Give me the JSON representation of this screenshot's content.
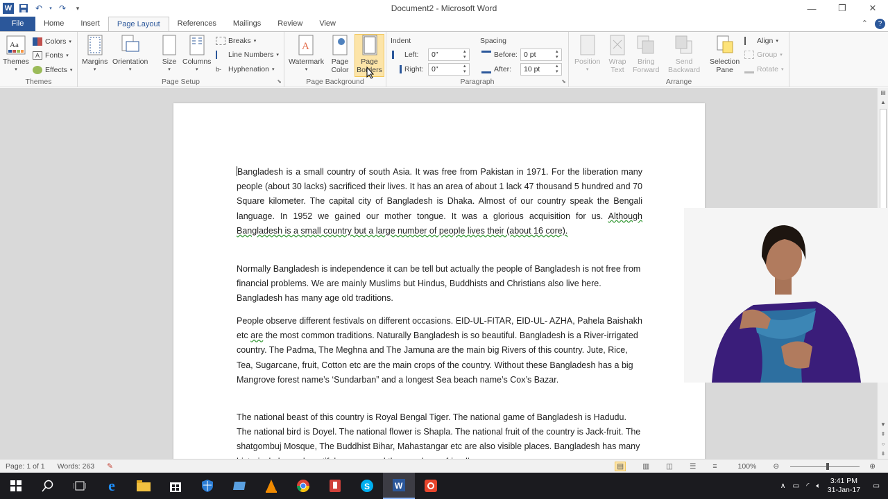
{
  "titlebar": {
    "title": "Document2  -  Microsoft Word",
    "minimize": "—",
    "restore": "❐",
    "close": "✕"
  },
  "tabs": [
    {
      "label": "File"
    },
    {
      "label": "Home"
    },
    {
      "label": "Insert"
    },
    {
      "label": "Page Layout"
    },
    {
      "label": "References"
    },
    {
      "label": "Mailings"
    },
    {
      "label": "Review"
    },
    {
      "label": "View"
    }
  ],
  "ribbon": {
    "themes": {
      "themes_label": "Themes",
      "colors": "Colors",
      "fonts": "Fonts",
      "effects": "Effects",
      "group_label": "Themes"
    },
    "page_setup": {
      "margins": "Margins",
      "orientation": "Orientation",
      "size": "Size",
      "columns": "Columns",
      "breaks": "Breaks",
      "line_numbers": "Line Numbers",
      "hyphenation": "Hyphenation",
      "group_label": "Page Setup"
    },
    "page_background": {
      "watermark": "Watermark",
      "page_color_1": "Page",
      "page_color_2": "Color",
      "page_borders_1": "Page",
      "page_borders_2": "Borders",
      "group_label": "Page Background"
    },
    "paragraph": {
      "indent_heading": "Indent",
      "left_label": "Left:",
      "left_value": "0\"",
      "right_label": "Right:",
      "right_value": "0\"",
      "spacing_heading": "Spacing",
      "before_label": "Before:",
      "before_value": "0 pt",
      "after_label": "After:",
      "after_value": "10 pt",
      "group_label": "Paragraph"
    },
    "arrange": {
      "position": "Position",
      "wrap_1": "Wrap",
      "wrap_2": "Text",
      "bring_1": "Bring",
      "bring_2": "Forward",
      "send_1": "Send",
      "send_2": "Backward",
      "selection_1": "Selection",
      "selection_2": "Pane",
      "align": "Align",
      "group": "Group",
      "rotate": "Rotate",
      "group_label": "Arrange"
    }
  },
  "document": {
    "p1_a": "Bangladesh is a small country of south Asia. It was free from Pakistan in 1971. For the liberation many people (about 30 lacks) sacrificed their lives. It has an area of about 1 lack 47 thousand 5 hundred and 70 Square kilometer. The capital city of Bangladesh is Dhaka. Almost of our country speak the Bengali language. In 1952 we gained our mother tongue. It was a glorious acquisition for us. ",
    "p1_b": "Although Bangladesh is a small country but a large number of people lives their (about 16 core).",
    "p2": " Normally Bangladesh is independence it can be tell but actually the people of Bangladesh is not free from financial problems. We are mainly Muslims but Hindus, Buddhists and Christians also live here. Bangladesh has many age old traditions.",
    "p3_a": "People observe different festivals on different occasions. EID-UL-FITAR, EID-UL- AZHA, Pahela Baishakh etc ",
    "p3_are": "are",
    "p3_b": " the most common traditions. Naturally Bangladesh is so beautiful. Bangladesh is a River-irrigated country. The Padma, The Meghna and The Jamuna are the main big Rivers of this country. Jute, Rice, Tea, Sugarcane, fruit, Cotton etc are the main crops of the country. Without these Bangladesh has a big Mangrove forest name’s ‘Sundarban” and a longest Sea beach name’s Cox’s Bazar.",
    "p4": "The national beast of this country is Royal Bengal Tiger. The national game of Bangladesh is Hadudu. The national bird is Doyel. The national flower is Shapla. The national fruit of the country is Jack-fruit. The shatgombuj Mosque, The Buddhist Bihar, Mahastangar etc are also visible places. Bangladesh has many historical places, beautiful scenery and the people are friendly."
  },
  "statusbar": {
    "page": "Page: 1 of 1",
    "words": "Words: 263",
    "zoom": "100%"
  },
  "taskbar": {
    "time": "3:41 PM",
    "date": "31-Jan-17"
  },
  "colors": {
    "word_blue": "#2b579a",
    "ribbon_bg": "#f8f8f8",
    "doc_bg": "#d9d9d9",
    "taskbar": "#1b1b1f"
  }
}
